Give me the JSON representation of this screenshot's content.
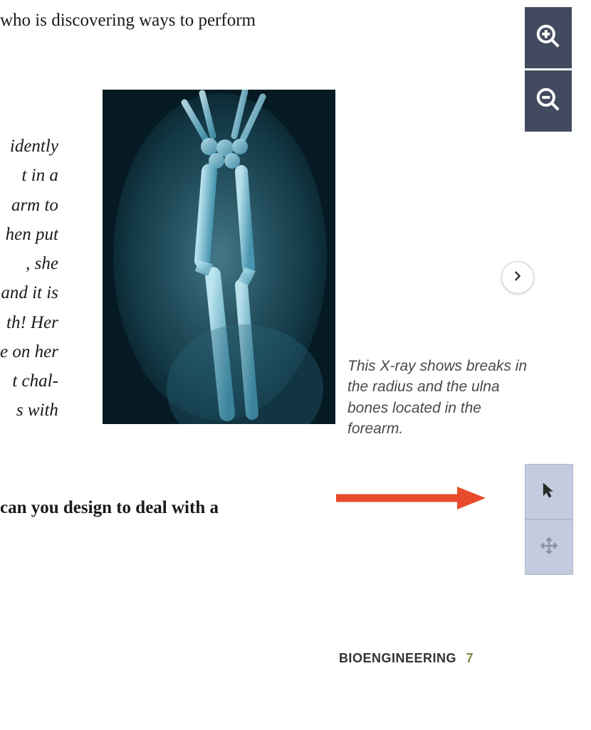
{
  "top_text": "who is discovering ways to perform",
  "body_fragments": [
    "idently",
    "t in a",
    " arm to",
    "hen put",
    ", she",
    "and it is",
    "th! Her",
    "e on her",
    "t chal-",
    "s with"
  ],
  "caption": "This X-ray shows breaks in the radius and the ulna bones located in the forearm.",
  "question": "can you design to deal with a",
  "footer": {
    "label": "BIOENGINEERING",
    "page": "7"
  },
  "icons": {
    "zoom_in": "zoom-in-icon",
    "zoom_out": "zoom-out-icon",
    "next": "chevron-right-icon",
    "pointer": "pointer-icon",
    "move": "move-icon"
  },
  "colors": {
    "toolbar_dark": "#414a5e",
    "toolbar_light": "#c3cbde",
    "arrow": "#e84b2c",
    "accent": "#7a8a3e"
  }
}
